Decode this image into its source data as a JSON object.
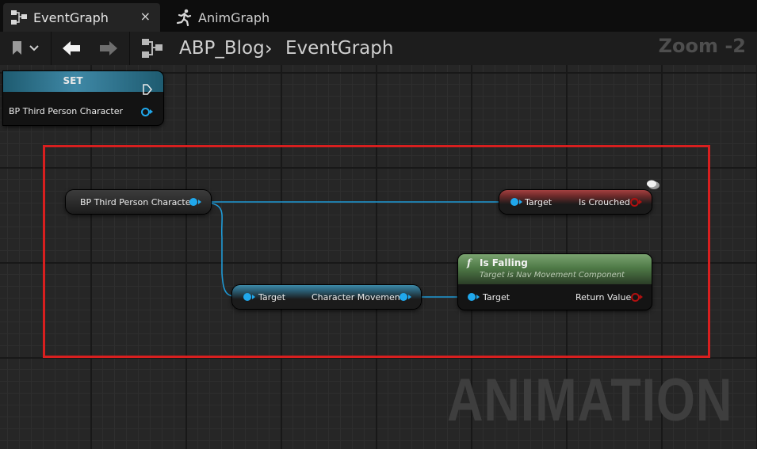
{
  "tabs": [
    {
      "label": "EventGraph",
      "icon": "event-graph-icon",
      "active": true,
      "close": "×"
    },
    {
      "label": "AnimGraph",
      "icon": "running-man-icon",
      "active": false
    }
  ],
  "toolbar": {
    "bookmark_icon": "bookmark-icon",
    "back_icon": "arrow-left-icon",
    "forward_icon": "arrow-right-icon",
    "graph_icon": "event-graph-icon",
    "breadcrumb": [
      "ABP_Blog",
      "EventGraph"
    ],
    "separator": "›",
    "zoom": "Zoom -2"
  },
  "watermark": "ANIMATION",
  "nodes": {
    "set": {
      "header": "SET",
      "pin_label": "BP Third Person Character"
    },
    "var": {
      "label": "BP Third Person Character"
    },
    "is_crouched": {
      "target": "Target",
      "output": "Is Crouched"
    },
    "char_movement": {
      "target": "Target",
      "output": "Character Movement"
    },
    "is_falling": {
      "title": "Is Falling",
      "subtitle": "Target is Nav Movement Component",
      "target": "Target",
      "output": "Return Value",
      "func_glyph": "f"
    }
  },
  "colors": {
    "object_pin": "#20a8ec",
    "bool_pin": "#b01010",
    "selection_box": "#d81f1f",
    "function_header": "#5f8a57"
  }
}
